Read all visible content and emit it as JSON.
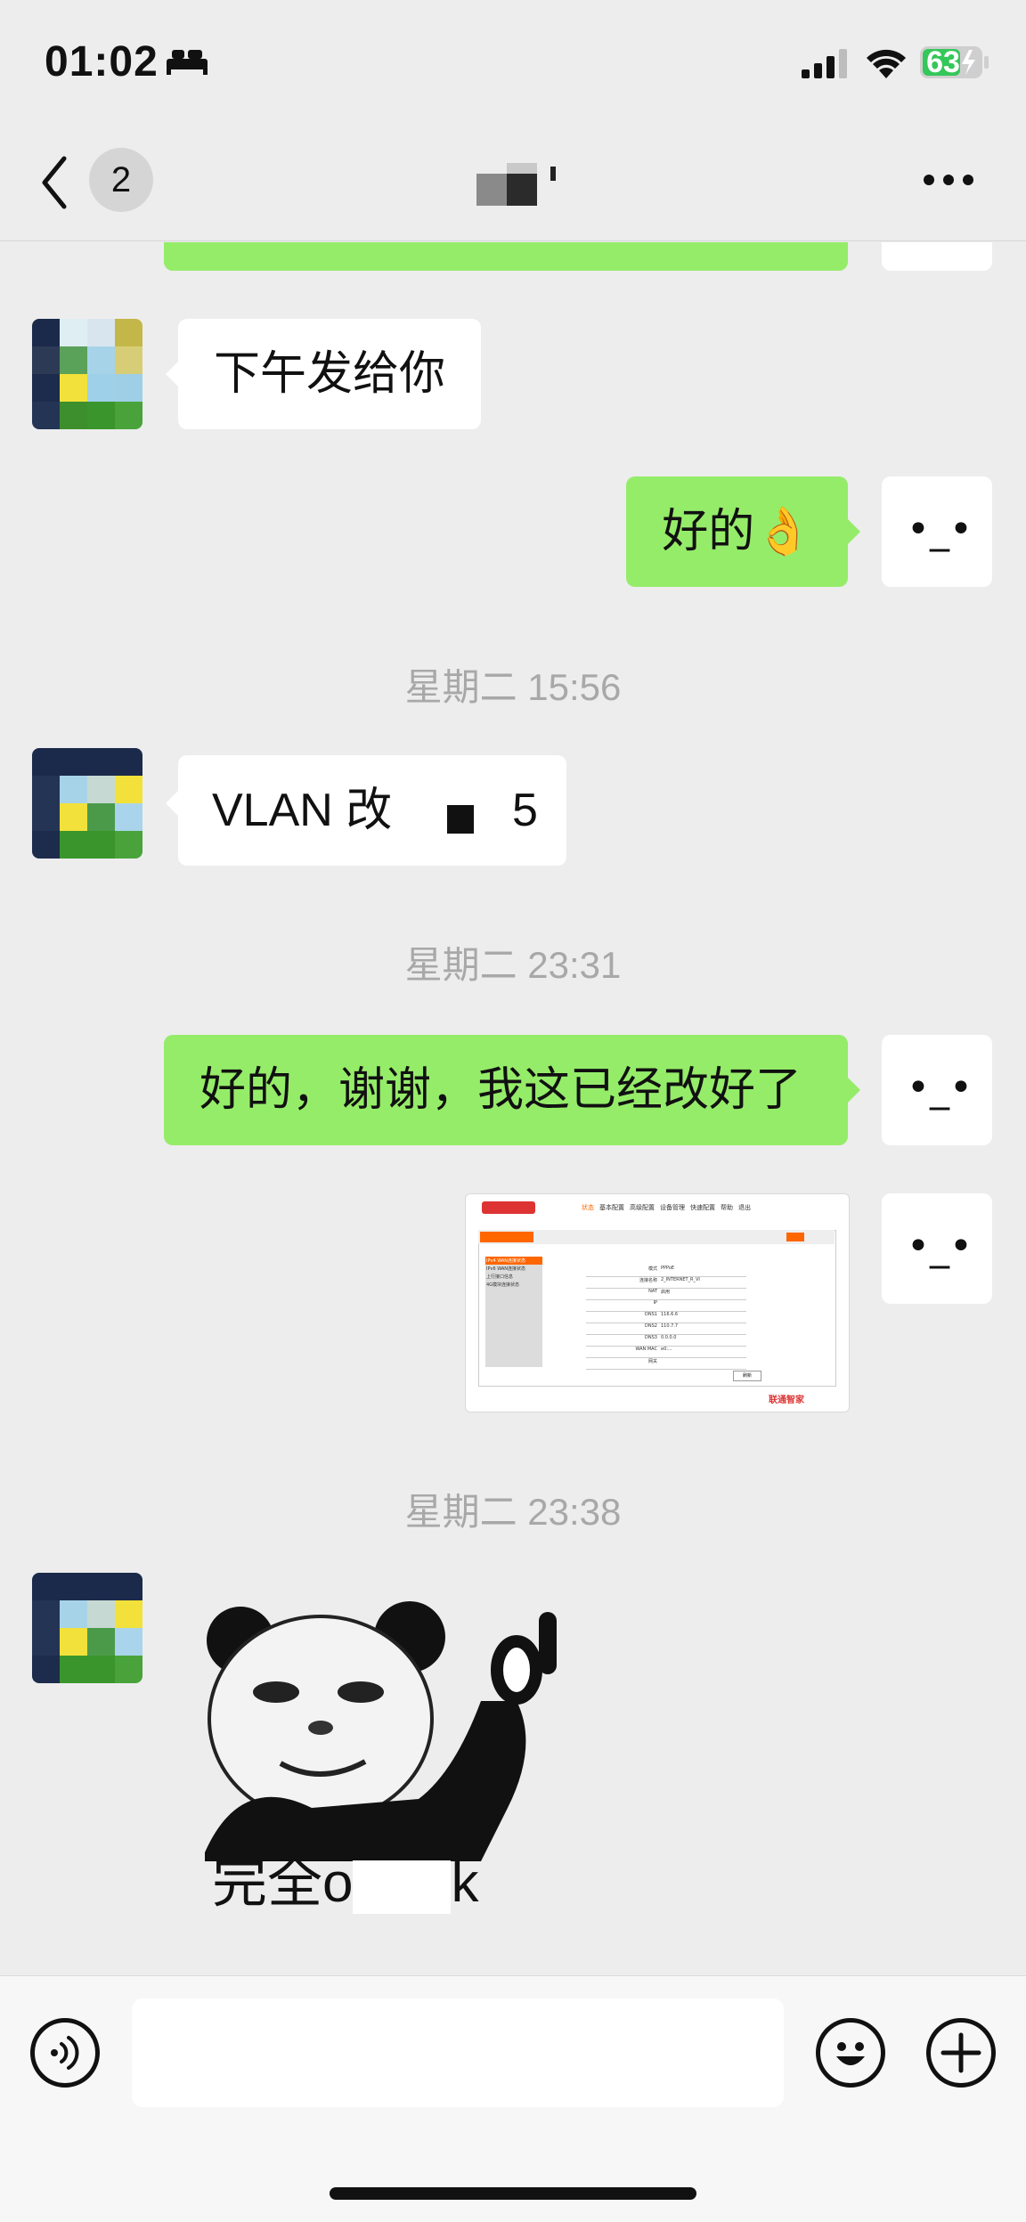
{
  "status_bar": {
    "time": "01:02",
    "battery": "63",
    "icons": [
      "bed-icon",
      "signal-icon",
      "wifi-icon",
      "battery-charging-icon"
    ]
  },
  "nav": {
    "unread_count": "2",
    "icons": [
      "chevron-left-icon",
      "more-icon"
    ]
  },
  "messages": {
    "m1": "下午发给你",
    "m2": "好的👌",
    "ts1": "星期二 15:56",
    "m3a": "VLAN 改",
    "m3b": "5",
    "ts2": "星期二 23:31",
    "m4": "好的，谢谢，我这已经改好了",
    "ts3": "星期二 23:38",
    "sticker_caption": "完全o",
    "sticker_caption_end": "k",
    "self_avatar_face": "•_•"
  },
  "screenshot_image": {
    "tabs": [
      "状态",
      "基本配置",
      "高级配置",
      "设备管理",
      "快速配置",
      "帮助",
      "退出"
    ],
    "panel_title": "IPv4 WAN连接状态",
    "sidebar": [
      "IPv4 WAN连接状态",
      "IPv6 WAN连接状态",
      "上行接口信息",
      "4G模块连接状态"
    ],
    "rows": [
      [
        "模式",
        "PPPoE"
      ],
      [
        "连接名称",
        "2_INTERNET_R_VI"
      ],
      [
        "NAT",
        "启用"
      ],
      [
        "IP",
        ""
      ],
      [
        "DNS1",
        "116.6.6"
      ],
      [
        "DNS2",
        "110.7.7"
      ],
      [
        "DNS3",
        "0.0.0.0"
      ],
      [
        "WAN MAC",
        "e0:..."
      ],
      [
        "网关",
        ""
      ]
    ],
    "button": "刷新",
    "brand": "联通智家"
  },
  "bottom_bar": {
    "icons": [
      "voice-icon",
      "emoji-icon",
      "plus-icon"
    ]
  },
  "colors": {
    "accent_green": "#95ec69",
    "background": "#ededed",
    "timestamp": "#a8a8a8"
  }
}
